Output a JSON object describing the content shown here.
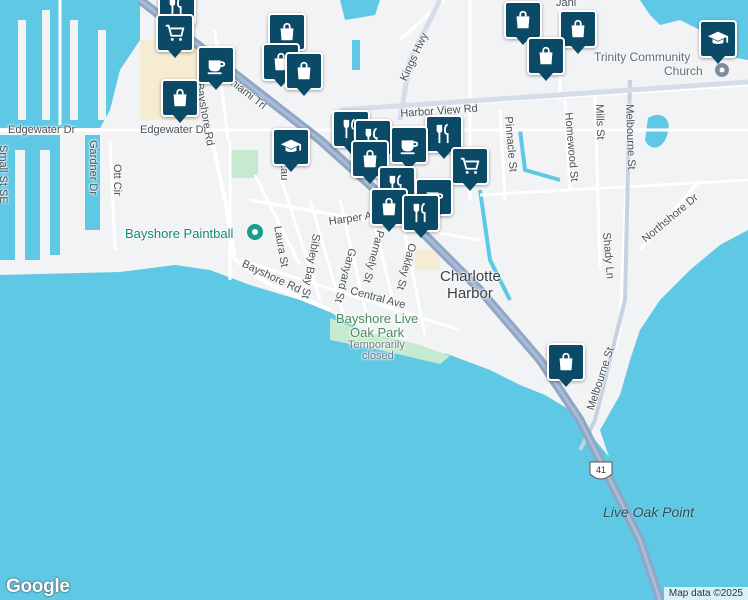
{
  "map": {
    "water_color": "#5ec8e5",
    "land_color": "#f1f3f4",
    "highway_color": "#8fa6c4",
    "poi_color": "#0b4a66"
  },
  "labels": {
    "edgewater_left": "Edgewater Dr",
    "edgewater_right": "Edgewater Dr",
    "bayshore_rd_north": "Bayshore Rd",
    "bayshore_rd_south": "Bayshore Rd",
    "tamiami": "Tamiami Trl",
    "kings_hwy": "Kings Hwy",
    "harbor_view": "Harbor View Rd",
    "pinnacle": "Pinnacle St",
    "homewood": "Homewood St",
    "mills": "Mills St",
    "melbourne_north": "Melbourne St",
    "melbourne_south": "Melbourne St",
    "shady": "Shady Ln",
    "northshore": "Northshore Dr",
    "harper": "Harper Ave",
    "laura": "Laura St",
    "sibley": "Sibley Bay St",
    "ganyard": "Ganyard St",
    "parmely": "Parmely St",
    "oakley": "Oakley St",
    "central": "Central Ave",
    "small": "Small St SE",
    "gardner": "Gardner Dr",
    "ott": "Ott Cir",
    "lau": "Lau",
    "jani": "Jani",
    "place_charlotte_1": "Charlotte",
    "place_charlotte_2": "Harbor",
    "live_oak_point": "Live Oak Point",
    "trinity_1": "Trinity Community",
    "trinity_2": "Church",
    "bayshore_paintball": "Bayshore Paintball",
    "park_1": "Bayshore Live",
    "park_2": "Oak Park",
    "park_status_1": "Temporarily",
    "park_status_2": "closed",
    "route_41": "41"
  },
  "pois": [
    {
      "type": "restaurant",
      "name": "restaurant-icon"
    },
    {
      "type": "shopping-cart",
      "name": "shopping-cart-icon"
    },
    {
      "type": "cafe",
      "name": "cafe-icon"
    },
    {
      "type": "shopping-bag",
      "name": "shopping-bag-icon"
    },
    {
      "type": "school",
      "name": "school-icon"
    }
  ],
  "footer": {
    "logo": "Google",
    "attribution": "Map data ©2025"
  }
}
